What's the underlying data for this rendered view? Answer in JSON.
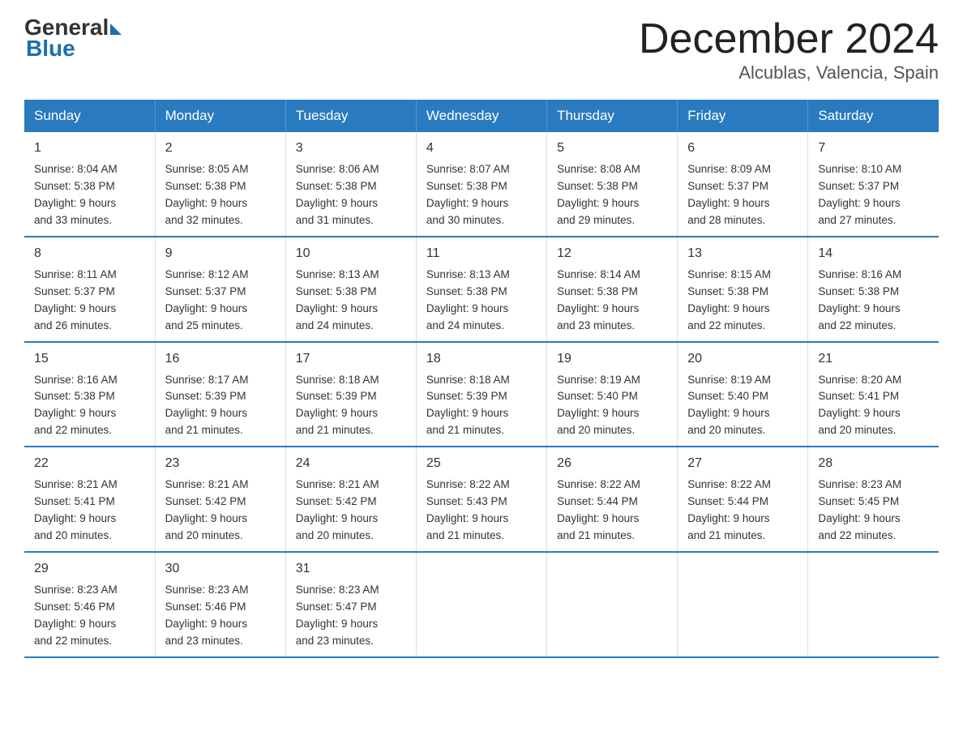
{
  "logo": {
    "general": "General",
    "blue": "Blue"
  },
  "title": "December 2024",
  "subtitle": "Alcublas, Valencia, Spain",
  "weekdays": [
    "Sunday",
    "Monday",
    "Tuesday",
    "Wednesday",
    "Thursday",
    "Friday",
    "Saturday"
  ],
  "weeks": [
    [
      {
        "day": "1",
        "info": "Sunrise: 8:04 AM\nSunset: 5:38 PM\nDaylight: 9 hours\nand 33 minutes."
      },
      {
        "day": "2",
        "info": "Sunrise: 8:05 AM\nSunset: 5:38 PM\nDaylight: 9 hours\nand 32 minutes."
      },
      {
        "day": "3",
        "info": "Sunrise: 8:06 AM\nSunset: 5:38 PM\nDaylight: 9 hours\nand 31 minutes."
      },
      {
        "day": "4",
        "info": "Sunrise: 8:07 AM\nSunset: 5:38 PM\nDaylight: 9 hours\nand 30 minutes."
      },
      {
        "day": "5",
        "info": "Sunrise: 8:08 AM\nSunset: 5:38 PM\nDaylight: 9 hours\nand 29 minutes."
      },
      {
        "day": "6",
        "info": "Sunrise: 8:09 AM\nSunset: 5:37 PM\nDaylight: 9 hours\nand 28 minutes."
      },
      {
        "day": "7",
        "info": "Sunrise: 8:10 AM\nSunset: 5:37 PM\nDaylight: 9 hours\nand 27 minutes."
      }
    ],
    [
      {
        "day": "8",
        "info": "Sunrise: 8:11 AM\nSunset: 5:37 PM\nDaylight: 9 hours\nand 26 minutes."
      },
      {
        "day": "9",
        "info": "Sunrise: 8:12 AM\nSunset: 5:37 PM\nDaylight: 9 hours\nand 25 minutes."
      },
      {
        "day": "10",
        "info": "Sunrise: 8:13 AM\nSunset: 5:38 PM\nDaylight: 9 hours\nand 24 minutes."
      },
      {
        "day": "11",
        "info": "Sunrise: 8:13 AM\nSunset: 5:38 PM\nDaylight: 9 hours\nand 24 minutes."
      },
      {
        "day": "12",
        "info": "Sunrise: 8:14 AM\nSunset: 5:38 PM\nDaylight: 9 hours\nand 23 minutes."
      },
      {
        "day": "13",
        "info": "Sunrise: 8:15 AM\nSunset: 5:38 PM\nDaylight: 9 hours\nand 22 minutes."
      },
      {
        "day": "14",
        "info": "Sunrise: 8:16 AM\nSunset: 5:38 PM\nDaylight: 9 hours\nand 22 minutes."
      }
    ],
    [
      {
        "day": "15",
        "info": "Sunrise: 8:16 AM\nSunset: 5:38 PM\nDaylight: 9 hours\nand 22 minutes."
      },
      {
        "day": "16",
        "info": "Sunrise: 8:17 AM\nSunset: 5:39 PM\nDaylight: 9 hours\nand 21 minutes."
      },
      {
        "day": "17",
        "info": "Sunrise: 8:18 AM\nSunset: 5:39 PM\nDaylight: 9 hours\nand 21 minutes."
      },
      {
        "day": "18",
        "info": "Sunrise: 8:18 AM\nSunset: 5:39 PM\nDaylight: 9 hours\nand 21 minutes."
      },
      {
        "day": "19",
        "info": "Sunrise: 8:19 AM\nSunset: 5:40 PM\nDaylight: 9 hours\nand 20 minutes."
      },
      {
        "day": "20",
        "info": "Sunrise: 8:19 AM\nSunset: 5:40 PM\nDaylight: 9 hours\nand 20 minutes."
      },
      {
        "day": "21",
        "info": "Sunrise: 8:20 AM\nSunset: 5:41 PM\nDaylight: 9 hours\nand 20 minutes."
      }
    ],
    [
      {
        "day": "22",
        "info": "Sunrise: 8:21 AM\nSunset: 5:41 PM\nDaylight: 9 hours\nand 20 minutes."
      },
      {
        "day": "23",
        "info": "Sunrise: 8:21 AM\nSunset: 5:42 PM\nDaylight: 9 hours\nand 20 minutes."
      },
      {
        "day": "24",
        "info": "Sunrise: 8:21 AM\nSunset: 5:42 PM\nDaylight: 9 hours\nand 20 minutes."
      },
      {
        "day": "25",
        "info": "Sunrise: 8:22 AM\nSunset: 5:43 PM\nDaylight: 9 hours\nand 21 minutes."
      },
      {
        "day": "26",
        "info": "Sunrise: 8:22 AM\nSunset: 5:44 PM\nDaylight: 9 hours\nand 21 minutes."
      },
      {
        "day": "27",
        "info": "Sunrise: 8:22 AM\nSunset: 5:44 PM\nDaylight: 9 hours\nand 21 minutes."
      },
      {
        "day": "28",
        "info": "Sunrise: 8:23 AM\nSunset: 5:45 PM\nDaylight: 9 hours\nand 22 minutes."
      }
    ],
    [
      {
        "day": "29",
        "info": "Sunrise: 8:23 AM\nSunset: 5:46 PM\nDaylight: 9 hours\nand 22 minutes."
      },
      {
        "day": "30",
        "info": "Sunrise: 8:23 AM\nSunset: 5:46 PM\nDaylight: 9 hours\nand 23 minutes."
      },
      {
        "day": "31",
        "info": "Sunrise: 8:23 AM\nSunset: 5:47 PM\nDaylight: 9 hours\nand 23 minutes."
      },
      {
        "day": "",
        "info": ""
      },
      {
        "day": "",
        "info": ""
      },
      {
        "day": "",
        "info": ""
      },
      {
        "day": "",
        "info": ""
      }
    ]
  ]
}
